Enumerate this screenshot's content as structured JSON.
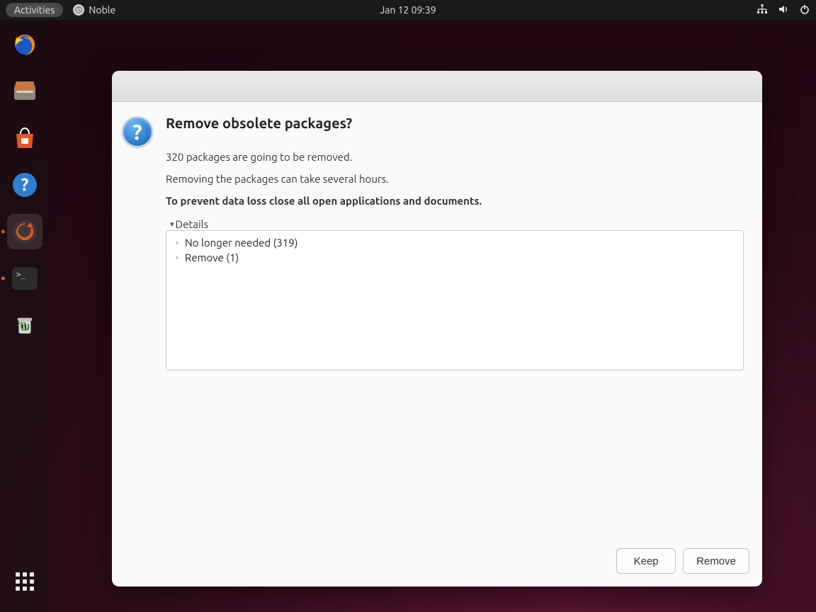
{
  "topbar": {
    "activities": "Activities",
    "app_name": "Noble",
    "clock": "Jan 12  09:39"
  },
  "dock": {
    "items": [
      {
        "name": "firefox"
      },
      {
        "name": "files"
      },
      {
        "name": "software"
      },
      {
        "name": "help"
      },
      {
        "name": "software-updater"
      },
      {
        "name": "terminal"
      },
      {
        "name": "trash"
      }
    ]
  },
  "dialog": {
    "heading": "Remove obsolete packages?",
    "line1": "320 packages are going to be removed.",
    "line2": "Removing the packages can take several hours.",
    "line3_bold": "To prevent data loss close all open applications and documents.",
    "details_label": "Details",
    "tree": [
      "No longer needed (319)",
      "Remove (1)"
    ],
    "buttons": {
      "keep": "Keep",
      "remove": "Remove"
    }
  }
}
